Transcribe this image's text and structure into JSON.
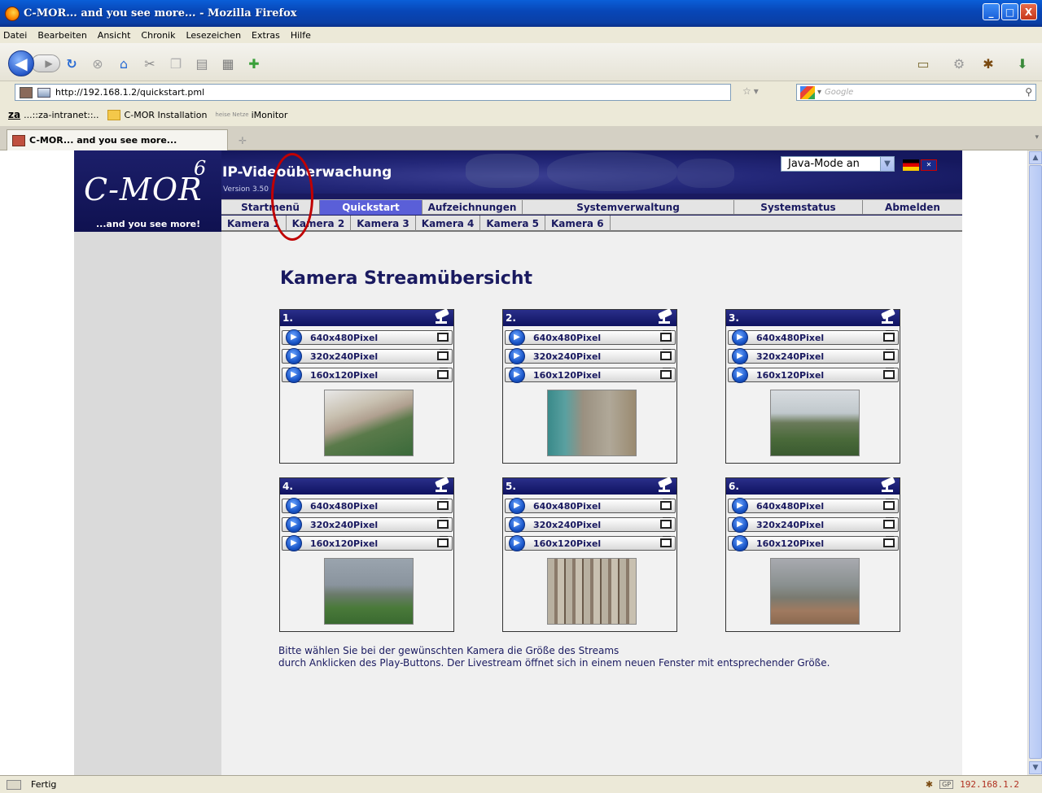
{
  "window": {
    "title": "C-MOR... and you see more... - Mozilla Firefox",
    "minimize": "_",
    "maximize": "□",
    "close": "X"
  },
  "menu": [
    "Datei",
    "Bearbeiten",
    "Ansicht",
    "Chronik",
    "Lesezeichen",
    "Extras",
    "Hilfe"
  ],
  "addressbar": {
    "url": "http://192.168.1.2/quickstart.pml"
  },
  "searchbar": {
    "placeholder": "Google"
  },
  "bookmarks": [
    {
      "label": "...::za-intranet::..",
      "icon": "za-icon"
    },
    {
      "label": "C-MOR Installation",
      "icon": "folder-icon"
    },
    {
      "label": "iMonitor",
      "icon": "heise-icon",
      "prefix": "heise Netze"
    }
  ],
  "tab": {
    "title": "C-MOR... and you see more..."
  },
  "status": {
    "text": "Fertig",
    "ip": "192.168.1.2",
    "gp": "GP"
  },
  "site": {
    "brand": "C-MOR",
    "brand_sup": "6",
    "tagline": "...and you see more!",
    "title": "IP-Videoüberwachung",
    "version": "Version 3.50",
    "java_mode": "Java-Mode an",
    "nav": [
      "Startmenü",
      "Quickstart",
      "Aufzeichnungen",
      "Systemverwaltung",
      "Systemstatus",
      "Abmelden"
    ],
    "active_nav": "Quickstart",
    "camera_nav": [
      "Kamera 1",
      "Kamera 2",
      "Kamera 3",
      "Kamera 4",
      "Kamera 5",
      "Kamera 6"
    ]
  },
  "main": {
    "heading": "Kamera Streamübersicht",
    "cameras": [
      {
        "label": "1.",
        "streams": [
          "640x480Pixel",
          "320x240Pixel",
          "160x120Pixel"
        ]
      },
      {
        "label": "2.",
        "streams": [
          "640x480Pixel",
          "320x240Pixel",
          "160x120Pixel"
        ]
      },
      {
        "label": "3.",
        "streams": [
          "640x480Pixel",
          "320x240Pixel",
          "160x120Pixel"
        ]
      },
      {
        "label": "4.",
        "streams": [
          "640x480Pixel",
          "320x240Pixel",
          "160x120Pixel"
        ]
      },
      {
        "label": "5.",
        "streams": [
          "640x480Pixel",
          "320x240Pixel",
          "160x120Pixel"
        ]
      },
      {
        "label": "6.",
        "streams": [
          "640x480Pixel",
          "320x240Pixel",
          "160x120Pixel"
        ]
      }
    ],
    "help_line1": "Bitte wählen Sie bei der gewünschten Kamera die Größe des Streams",
    "help_line2": "durch Anklicken des Play-Buttons. Der Livestream öffnet sich in einem neuen Fenster mit entsprechender Größe."
  },
  "colors": {
    "accent": "#1a1a60",
    "active_tab": "#5a5fd8",
    "highlight_circle": "#c00000"
  }
}
